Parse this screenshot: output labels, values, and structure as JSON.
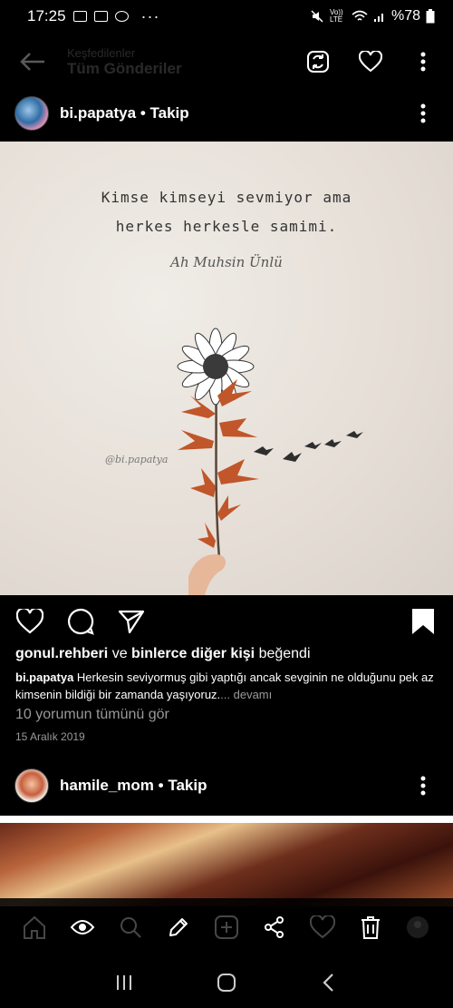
{
  "status_bar": {
    "time": "17:25",
    "volte": "Vo)) LTE",
    "battery": "%78"
  },
  "top_bar": {
    "subtitle": "Keşfedilenler",
    "title": "Tüm Gönderiler"
  },
  "post1": {
    "username": "bi.papatya",
    "follow": "• Takip",
    "quote_line1": "Kimse kimseyi sevmiyor ama",
    "quote_line2": "herkes herkesle samimi.",
    "signature": "Ah Muhsin Ünlü",
    "watermark": "@bi.papatya",
    "liked_by_user": "gonul.rehberi",
    "liked_by_connector": "ve",
    "liked_by_others": "binlerce diğer kişi",
    "liked_suffix": "beğendi",
    "caption_user": "bi.papatya",
    "caption_text": "Herkesin seviyormuş gibi yaptığı ancak sevginin ne olduğunu pek az kimsenin bildiği bir zamanda yaşıyoruz.",
    "caption_more": "... devamı",
    "comments": "10 yorumun tümünü gör",
    "date": "15 Aralık 2019"
  },
  "post2": {
    "username": "hamile_mom",
    "follow": "• Takip"
  },
  "colors": {
    "background": "#000000",
    "text": "#ffffff",
    "muted": "#999999",
    "photo_bg": "#e8e2db",
    "leaf": "#c0562a"
  }
}
